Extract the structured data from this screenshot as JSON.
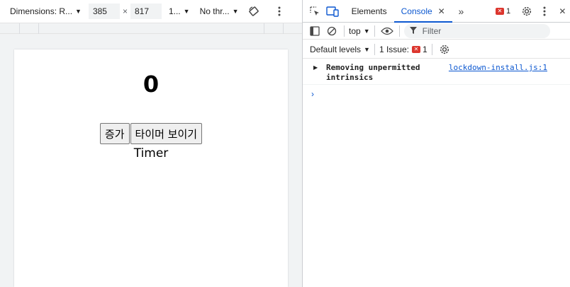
{
  "device_toolbar": {
    "dimensions_label": "Dimensions: R...",
    "width_value": "385",
    "times": "×",
    "height_value": "817",
    "zoom_label": "1...",
    "throttle_label": "No thr..."
  },
  "page": {
    "count": "0",
    "increase_button": "증가",
    "show_timer_button": "타이머 보이기",
    "timer_text": "Timer"
  },
  "devtools": {
    "tabs": [
      {
        "label": "Elements",
        "active": false
      },
      {
        "label": "Console",
        "active": true
      }
    ],
    "more_tabs": "»",
    "error_count": "1",
    "console_toolbar": {
      "context": "top",
      "filter_placeholder": "Filter"
    },
    "levels": {
      "default_levels": "Default levels",
      "issues_label": "1 Issue:",
      "issues_count": "1"
    },
    "messages": [
      {
        "text": "Removing unpermitted intrinsics",
        "source": "lockdown-install.js:1"
      }
    ]
  },
  "colors": {
    "accent": "#0b57d0",
    "error": "#dc362e"
  }
}
